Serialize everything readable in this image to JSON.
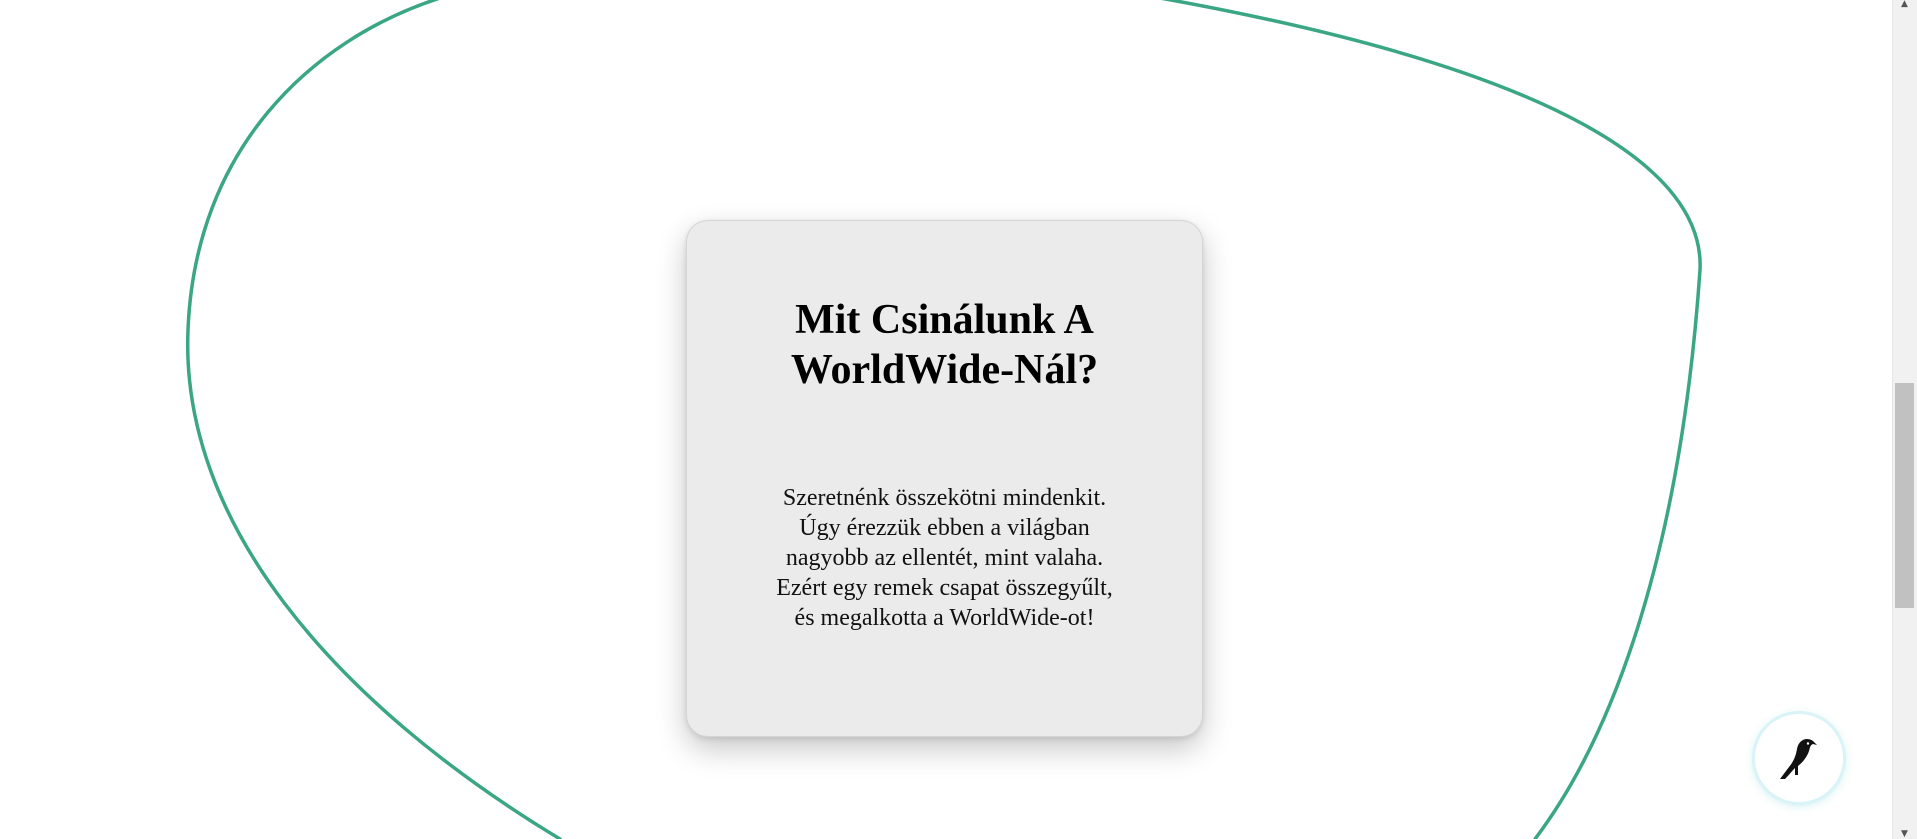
{
  "card": {
    "title": "Mit Csinálunk A WorldWide-Nál?",
    "text": "Szeretnénk összekötni mindenkit. Úgy érezzük ebben a világban nagyobb az ellentét, mint valaha. Ezért egy remek csapat összegyűlt, és megalkotta a WorldWide-ot!"
  },
  "floating_button": {
    "icon": "bird-icon"
  },
  "colors": {
    "blob_stroke": "#3aa684",
    "card_background": "#eaebea",
    "fab_glow": "#d9f3f6"
  }
}
